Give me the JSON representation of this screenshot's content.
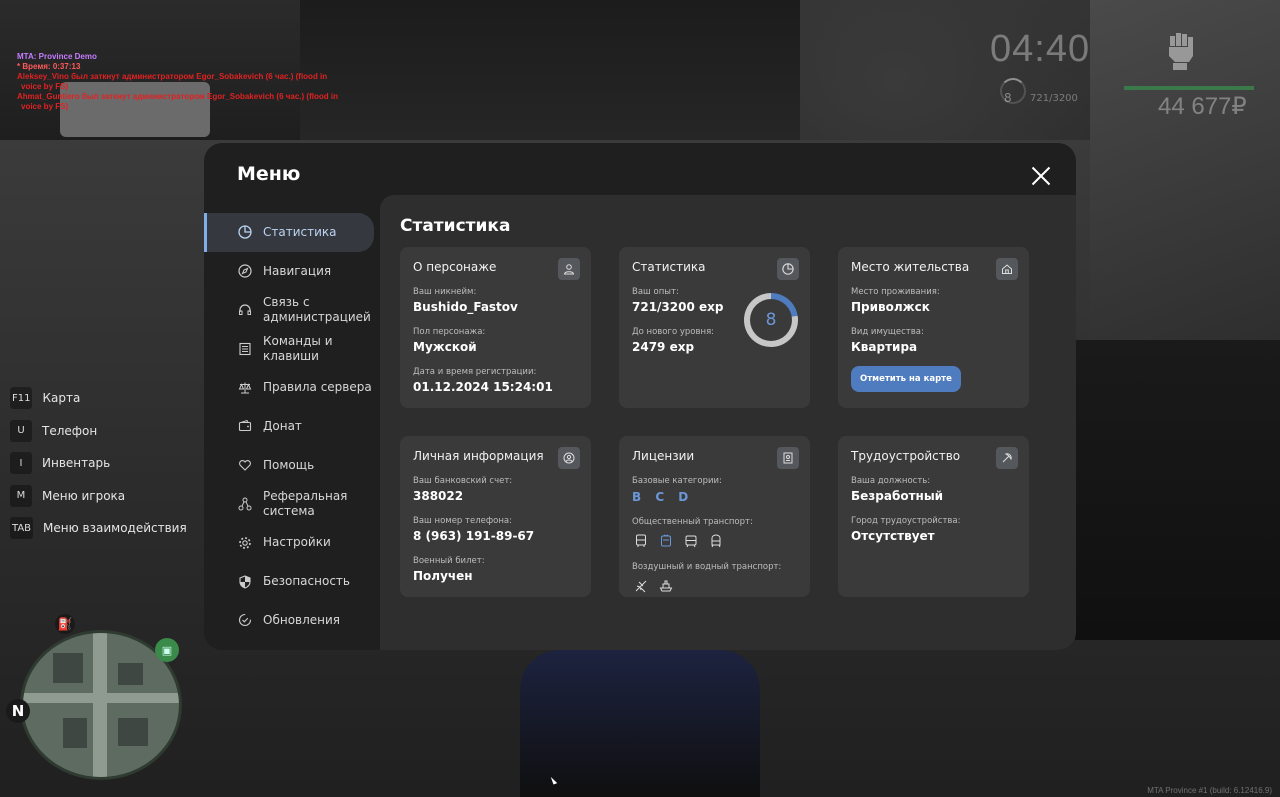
{
  "chat": [
    "MTA: Province Demo",
    "* Время: 0:37:13",
    "Aleksey_Vino был заткнут администратором Egor_Sobakevich (6 час.) (flood in",
    "voice by FS)",
    "Ahmat_Guntiero был заткнут администратором Egor_Sobakevich (6 час.) (flood in",
    "voice by FS)"
  ],
  "hud": {
    "time": "04:40",
    "level": "8",
    "exp": "721/3200",
    "money": "44 677₽",
    "fist_icon": "fist-icon"
  },
  "keybinds": [
    {
      "key": "F11",
      "label": "Карта"
    },
    {
      "key": "U",
      "label": "Телефон"
    },
    {
      "key": "I",
      "label": "Инвентарь"
    },
    {
      "key": "M",
      "label": "Меню игрока"
    },
    {
      "key": "TAB",
      "label": "Меню взаимодействия"
    }
  ],
  "minimap": {
    "north": "N"
  },
  "build_info": "MTA Province #1 (build: 6.12416.9)",
  "menu": {
    "title": "Меню",
    "nav": [
      {
        "label": "Статистика",
        "icon": "pie-chart-icon",
        "active": true
      },
      {
        "label": "Навигация",
        "icon": "compass-icon"
      },
      {
        "label": "Связь с\nадминистрацией",
        "icon": "headset-icon"
      },
      {
        "label": "Команды и\nклавиши",
        "icon": "list-icon"
      },
      {
        "label": "Правила сервера",
        "icon": "scales-icon"
      },
      {
        "label": "Донат",
        "icon": "wallet-icon"
      },
      {
        "label": "Помощь",
        "icon": "heart-hand-icon"
      },
      {
        "label": "Реферальная\nсистема",
        "icon": "referral-icon"
      },
      {
        "label": "Настройки",
        "icon": "gear-icon"
      },
      {
        "label": "Безопасность",
        "icon": "shield-icon"
      },
      {
        "label": "Обновления",
        "icon": "refresh-icon"
      }
    ]
  },
  "content": {
    "title": "Статистика",
    "character": {
      "title": "О персонаже",
      "nick_label": "Ваш никнейм:",
      "nick": "Bushido_Fastov",
      "gender_label": "Пол персонажа:",
      "gender": "Мужской",
      "reg_label": "Дата и время регистрации:",
      "reg": "01.12.2024 15:24:01"
    },
    "stats": {
      "title": "Статистика",
      "exp_label": "Ваш опыт:",
      "exp": "721/3200 exp",
      "next_label": "До нового уровня:",
      "next": "2479 exp",
      "level": "8",
      "progress": 0.225
    },
    "residence": {
      "title": "Место жительства",
      "place_label": "Место проживания:",
      "place": "Приволжск",
      "property_label": "Вид имущества:",
      "property": "Квартира",
      "button": "Отметить на карте"
    },
    "personal": {
      "title": "Личная информация",
      "bank_label": "Ваш банковский счет:",
      "bank": "388022",
      "phone_label": "Ваш номер телефона:",
      "phone": "8 (963) 191-89-67",
      "military_label": "Военный билет:",
      "military": "Получен"
    },
    "licenses": {
      "title": "Лицензии",
      "base_label": "Базовые категории:",
      "base": "B C D",
      "public_label": "Общественный транспорт:",
      "air_label": "Воздушный и водный транспорт:"
    },
    "employment": {
      "title": "Трудоустройство",
      "position_label": "Ваша должность:",
      "position": "Безработный",
      "city_label": "Город трудоустройства:",
      "city": "Отсутствует"
    }
  }
}
